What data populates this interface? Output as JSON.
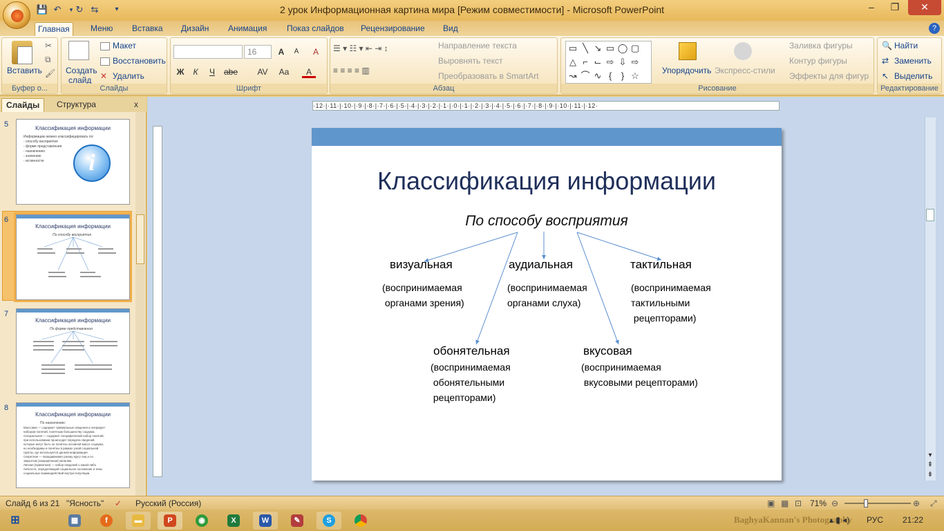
{
  "window": {
    "title": "2 урок Информационная картина мира [Режим совместимости] - Microsoft PowerPoint",
    "min": "–",
    "max": "❐",
    "close": "✕"
  },
  "tabs": [
    "Главная",
    "Меню",
    "Вставка",
    "Дизайн",
    "Анимация",
    "Показ слайдов",
    "Рецензирование",
    "Вид"
  ],
  "ribbon": {
    "clipboard": {
      "paste": "Вставить",
      "label": "Буфер о..."
    },
    "slides": {
      "new_slide": "Создать",
      "new_slide2": "слайд",
      "layout": "Макет",
      "reset": "Восстановить",
      "delete": "Удалить",
      "label": "Слайды"
    },
    "font": {
      "size": "16",
      "bold": "Ж",
      "italic": "К",
      "underline": "Ч",
      "strike": "abe",
      "spacing": "AV",
      "case": "Aa",
      "color": "A",
      "grow": "A",
      "shrink": "A",
      "clear": "A",
      "label": "Шрифт"
    },
    "paragraph": {
      "direction": "Направление текста",
      "align": "Выровнять текст",
      "smartart": "Преобразовать в SmartArt",
      "label": "Абзац"
    },
    "drawing": {
      "arrange": "Упорядочить",
      "styles": "Экспресс-стили",
      "fill": "Заливка фигуры",
      "outline": "Контур фигуры",
      "effects": "Эффекты для фигур",
      "label": "Рисование"
    },
    "editing": {
      "find": "Найти",
      "replace": "Заменить",
      "select": "Выделить",
      "label": "Редактирование"
    }
  },
  "pane": {
    "tab_slides": "Слайды",
    "tab_outline": "Структура",
    "close": "x"
  },
  "thumbnails": [
    {
      "num": "5",
      "title": "Классификация информации",
      "lines": [
        "Информацию можно классифицировать по:",
        "- способу восприятия",
        "- форме представления",
        "- назначению",
        "- значению",
        "- истинности"
      ]
    },
    {
      "num": "6",
      "title": "Классификация информации",
      "lines": [
        "По способу восприятия"
      ]
    },
    {
      "num": "7",
      "title": "Классификация информации",
      "lines": [
        "По форме представления"
      ]
    },
    {
      "num": "8",
      "title": "Классификация информации",
      "lines": [
        "По назначению:",
        "Массовая — содержит тривиальные сведения и оперирует",
        "набором понятий, понятным большинству социума.",
        "Специальная — содержит специфический набор понятий,",
        "при использовании происходит передача сведений,",
        "которые могут быть не понятны основной массе социума,",
        "но необходимы и понятны в рамках узкой социальной",
        "группы, где используется данная информация.",
        "Секретная — передаваемая узкому кругу лиц и по",
        "закрытым (защищённым) каналам.",
        "Личная (приватная) — набор сведений о какой-либо",
        "личности, определяющий социальное положение и типы",
        "социальных взаимодействий внутри популяции."
      ]
    }
  ],
  "ruler": {
    "h": "·12·|·11·|·10·|·9·|·8·|·7·|·6·|·5·|·4·|·3·|·2·|·1·|·0·|·1·|·2·|·3·|·4·|·5·|·6·|·7·|·8·|·9·|·10·|·11·|·12·"
  },
  "slide": {
    "title": "Классификация информации",
    "subtitle": "По способу восприятия",
    "categories": [
      {
        "name": "визуальная",
        "desc": "(воспринимаемая\n органами зрения)"
      },
      {
        "name": "аудиальная",
        "desc": "(воспринимаемая\nорганами слуха)"
      },
      {
        "name": "тактильная",
        "desc": "(воспринимаемая\nтактильными\n рецепторами)"
      },
      {
        "name": "обонятельная",
        "desc": "(воспринимаемая\n обонятельными\n рецепторами)"
      },
      {
        "name": "вкусовая",
        "desc": "(воспринимаемая\n вкусовыми рецепторами)"
      }
    ]
  },
  "status": {
    "slide": "Слайд 6 из 21",
    "theme": "\"Ясность\"",
    "language": "Русский (Россия)",
    "zoom": "71%"
  },
  "taskbar": {
    "lang": "РУС",
    "time": "21:22",
    "watermark": "BaghyaKannan's Photography"
  }
}
